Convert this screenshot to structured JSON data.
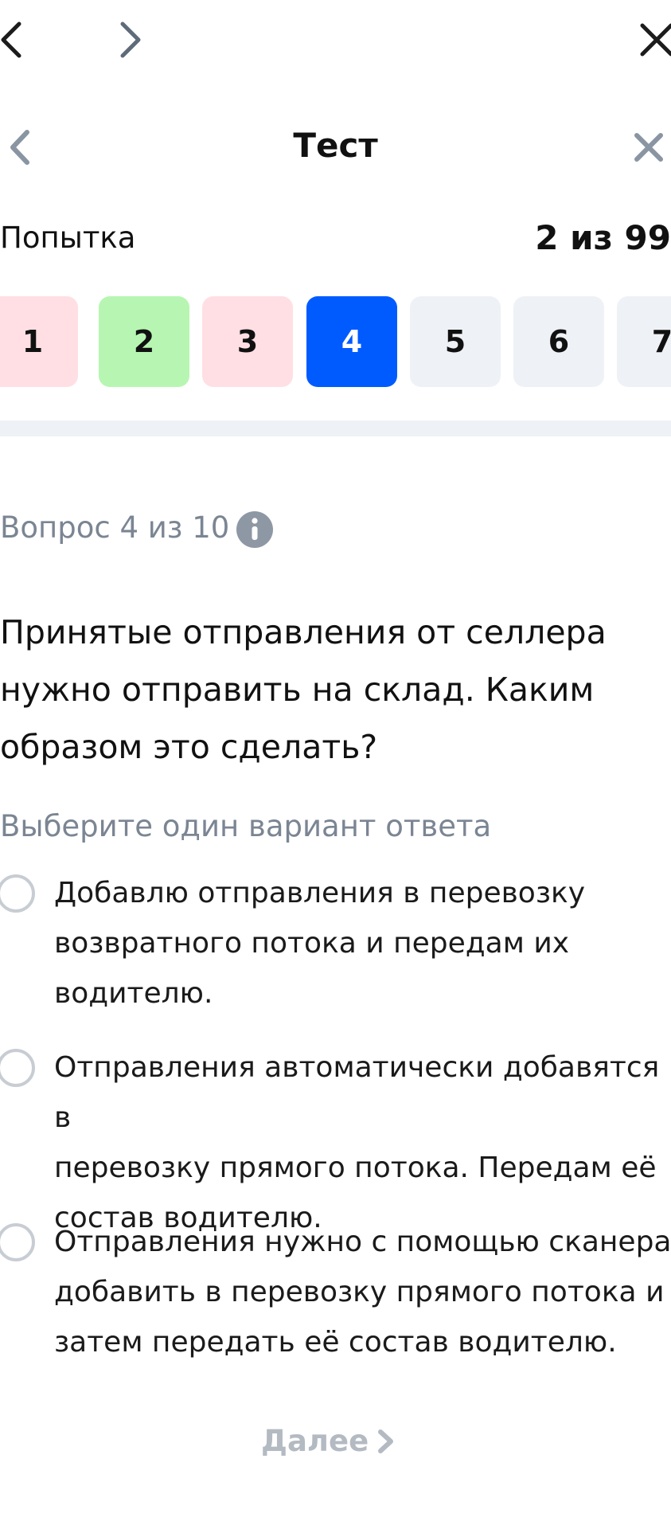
{
  "browser_nav": {
    "back_icon": "chevron-left-icon",
    "forward_icon": "chevron-right-icon",
    "close_icon": "close-icon"
  },
  "header": {
    "title": "Тест",
    "back_icon": "chevron-left-icon",
    "close_icon": "close-icon"
  },
  "attempt": {
    "label": "Попытка",
    "value": "2 из 99"
  },
  "tiles": [
    {
      "label": "1",
      "state": "wrong",
      "bg": "#ffdfe4",
      "fg": "#111111"
    },
    {
      "label": "2",
      "state": "correct",
      "bg": "#b7f6b2",
      "fg": "#111111"
    },
    {
      "label": "3",
      "state": "wrong",
      "bg": "#ffdfe4",
      "fg": "#111111"
    },
    {
      "label": "4",
      "state": "current",
      "bg": "#005bff",
      "fg": "#ffffff"
    },
    {
      "label": "5",
      "state": "unanswered",
      "bg": "#eef1f5",
      "fg": "#111111"
    },
    {
      "label": "6",
      "state": "unanswered",
      "bg": "#eef1f5",
      "fg": "#111111"
    },
    {
      "label": "7",
      "state": "unanswered",
      "bg": "#eef1f5",
      "fg": "#111111"
    }
  ],
  "question": {
    "counter": "Вопрос 4 из 10",
    "info_icon": "info-icon",
    "text_lines": [
      "Принятые отправления от селлера",
      "нужно отправить на склад. Каким",
      "образом это сделать?"
    ],
    "hint": "Выберите один вариант ответа"
  },
  "options": [
    {
      "lines": [
        "Добавлю отправления в перевозку",
        "возвратного потока и передам их",
        "водителю."
      ],
      "selected": false
    },
    {
      "lines": [
        "Отправления автоматически добавятся в",
        "перевозку прямого потока. Передам её",
        "состав водителю."
      ],
      "selected": false
    },
    {
      "lines": [
        "Отправления нужно с помощью сканера",
        "добавить в перевозку прямого потока и",
        "затем передать её состав водителю."
      ],
      "selected": false
    }
  ],
  "footer": {
    "next_label": "Далее",
    "next_icon": "chevron-right-icon"
  },
  "colors": {
    "accent": "#005bff",
    "muted_text": "#7b8593",
    "disabled": "#b4bac2"
  }
}
